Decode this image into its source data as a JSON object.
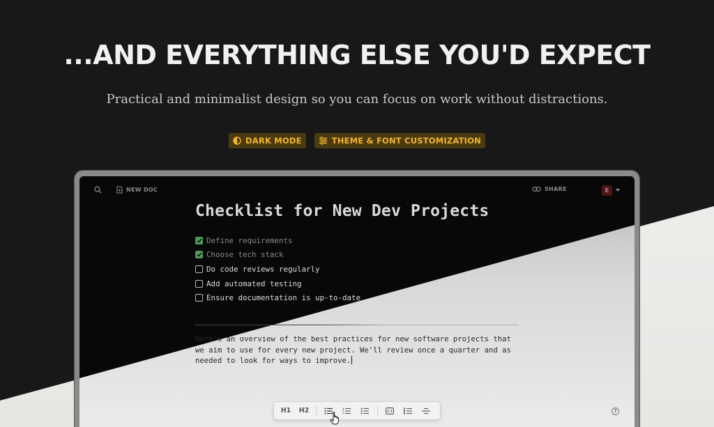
{
  "hero": {
    "title": "...AND EVERYTHING ELSE YOU'D EXPECT",
    "subtitle": "Practical and minimalist design so you can focus on work without distractions.",
    "badges": [
      {
        "label": "DARK MODE",
        "icon": "contrast-icon"
      },
      {
        "label": "THEME & FONT CUSTOMIZATION",
        "icon": "sliders-icon"
      }
    ]
  },
  "colors": {
    "accent": "#f2b531",
    "badge_bg": "#4a3a12",
    "check_green": "#4f9b5b",
    "page_dark": "#181818"
  },
  "app": {
    "topbar": {
      "search_icon": "search-icon",
      "new_doc_label": "NEW DOC",
      "share_label": "SHARE",
      "avatar_initial": "E"
    },
    "doc": {
      "title": "Checklist for New Dev Projects",
      "checklist": [
        {
          "text": "Define requirements",
          "checked": true
        },
        {
          "text": "Choose tech stack",
          "checked": true
        },
        {
          "text": "Do code reviews regularly",
          "checked": false
        },
        {
          "text": "Add automated testing",
          "checked": false
        },
        {
          "text": "Ensure documentation is up-to-date",
          "checked": false
        }
      ],
      "paragraph_lines": [
        "Here's an overview of the best practices for new software projects that",
        "we aim to use for every new project. We'll review once a quarter and as",
        "needed to look for ways to improve."
      ]
    },
    "toolbar": {
      "h1": "H1",
      "h2": "H2",
      "tools": [
        "bullet-list-icon",
        "numbered-list-icon",
        "checklist-icon",
        "code-block-icon",
        "quote-icon",
        "divider-icon"
      ]
    },
    "help_label": "?"
  }
}
